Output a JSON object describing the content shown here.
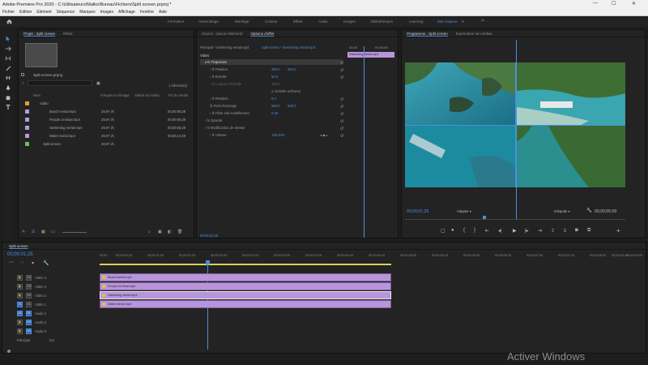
{
  "window": {
    "title": "Adobe Premiere Pro 2020 - C:\\Utilisateurs\\Malko\\Bureau\\Fichiers\\Split screen.prproj *",
    "minimize": "—",
    "maximize": "☐",
    "close": "✕"
  },
  "menu": [
    "Fichier",
    "Edition",
    "Elément",
    "Séquence",
    "Marques",
    "Images",
    "Affichage",
    "Fenêtre",
    "Aide"
  ],
  "workspaces": [
    "Formation",
    "Assemblage",
    "Montage",
    "Couleur",
    "Effets",
    "Audio",
    "Images",
    "Bibliothèques",
    "Learning",
    "Mon espace"
  ],
  "home_icon": "home-icon",
  "project": {
    "tabs": [
      "Projet : Split screen",
      "Effets"
    ],
    "file_name": "Split screen.prproj",
    "item_count": "1 élément(s)",
    "columns": [
      "Nom",
      "Fréquence d'image",
      "Début du média",
      "Fin du média"
    ],
    "bin": "Vidéo",
    "items": [
      {
        "name": "Beach Aerial.mp4",
        "fps": "29,97 i/s",
        "end": "00;00;05;29",
        "color": "#b39ddb"
      },
      {
        "name": "People on Boat.mp4",
        "fps": "29,97 i/s",
        "end": "00;00;06;29",
        "color": "#b39ddb"
      },
      {
        "name": "Swimming Aerial.mp4",
        "fps": "29,97 i/s",
        "end": "00;00;06;29",
        "color": "#b39ddb"
      },
      {
        "name": "Water Aerial.mp4",
        "fps": "29,97 i/s",
        "end": "00;00;14;29",
        "color": "#b39ddb"
      },
      {
        "name": "Split screen",
        "fps": "29,97 i/s",
        "end": "",
        "color": "#6fbf5a"
      }
    ]
  },
  "effects": {
    "tabs": [
      "Source : (aucun élément)",
      "Options d'effet"
    ],
    "master": "Principal * Swimming Aerial.mp4",
    "seq": "Split screen * Swimming Aerial.mp4",
    "mini_time": "00;00",
    "mini_time2": "00;00;05",
    "clip_label": "Swimming Aerial.mp4",
    "section": "Vidéo",
    "rows": [
      {
        "label": "Trajectoire",
        "v1": "",
        "v2": ""
      },
      {
        "label": "Position",
        "v1": "480,0",
        "v2": "810,0"
      },
      {
        "label": "Échelle",
        "v1": "50,0",
        "v2": ""
      },
      {
        "label": "Largeur d'échelle",
        "v1": "100,0",
        "v2": ""
      },
      {
        "label": "Échelle uniforme",
        "v1": "",
        "v2": ""
      },
      {
        "label": "Rotation",
        "v1": "0,0",
        "v2": ""
      },
      {
        "label": "Point d'ancrage",
        "v1": "960,0",
        "v2": "540,0"
      },
      {
        "label": "Filtre anti-scintillement",
        "v1": "0,00",
        "v2": ""
      },
      {
        "label": "Opacité",
        "v1": "",
        "v2": ""
      },
      {
        "label": "Modification de vitesse",
        "v1": "",
        "v2": ""
      },
      {
        "label": "Vitesse",
        "v1": "100,00%",
        "v2": ""
      }
    ],
    "time": "00;00;01;25"
  },
  "program": {
    "tabs": [
      "Programme : Split screen",
      "Explorateur de médias"
    ],
    "timecode": "00;00;01;25",
    "fit": "Adapter",
    "quality": "Intégrale",
    "duration": "00;00;05;00"
  },
  "timeline": {
    "tab": "Split screen",
    "timecode": "00;00;01;25",
    "ruler": [
      "00;00",
      "00;00;00;15",
      "00;00;01;00",
      "00;00;01;15",
      "00;00;02;00",
      "00;00;02;15",
      "00;00;03;00",
      "00;00;03;15",
      "00;00;04;00",
      "00;00;04;15",
      "00;00;05;00",
      "00;00;05;15",
      "00;00;06;00",
      "00;00;06;15",
      "00;00;07;00",
      "00;00;07;15",
      "00;00;08;00",
      "00;00;08;15",
      "00;00;09;00"
    ],
    "video_tracks": [
      {
        "id": "V4",
        "label": "Vidéo 4",
        "clip": "Beach Aerial.mp4"
      },
      {
        "id": "V3",
        "label": "Vidéo 3",
        "clip": "People on Boat.mp4"
      },
      {
        "id": "V2",
        "label": "Vidéo 2",
        "clip": "Swimming Aerial.mp4"
      },
      {
        "id": "V1",
        "label": "Vidéo 1",
        "clip": "Water Aerial.mp4"
      }
    ],
    "audio_tracks": [
      {
        "id": "A1",
        "label": "Audio 1"
      },
      {
        "id": "A2",
        "label": "Audio 2"
      },
      {
        "id": "A3",
        "label": "Audio 3"
      }
    ],
    "master_label": "Principal",
    "master_value": "0,0"
  },
  "watermark": "Activer Windows"
}
